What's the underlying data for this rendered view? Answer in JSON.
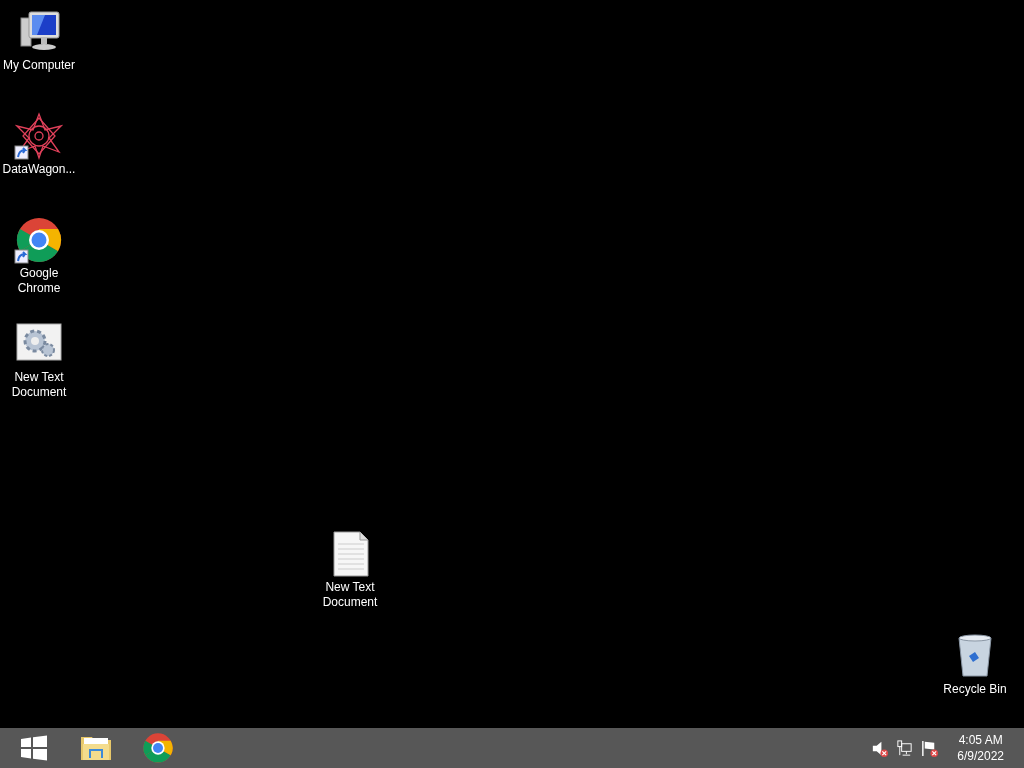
{
  "desktop_icons": [
    {
      "label": "My Computer",
      "kind": "computer",
      "shortcut": false
    },
    {
      "label": "DataWagon...",
      "kind": "star",
      "shortcut": true
    },
    {
      "label": "Google Chrome",
      "kind": "browser",
      "shortcut": true
    },
    {
      "label": "New Text Document",
      "kind": "gears",
      "shortcut": false
    }
  ],
  "loose_icons": [
    {
      "label": "New Text Document",
      "kind": "textfile"
    },
    {
      "label": "Recycle Bin",
      "kind": "bin"
    }
  ],
  "taskbar": {
    "items": [
      {
        "kind": "start"
      },
      {
        "kind": "folder"
      },
      {
        "kind": "browser"
      }
    ],
    "tray": [
      {
        "kind": "speaker",
        "error": true
      },
      {
        "kind": "network",
        "error": false
      },
      {
        "kind": "flag",
        "error": true
      }
    ],
    "time": "4:05 AM",
    "date": "6/9/2022"
  }
}
